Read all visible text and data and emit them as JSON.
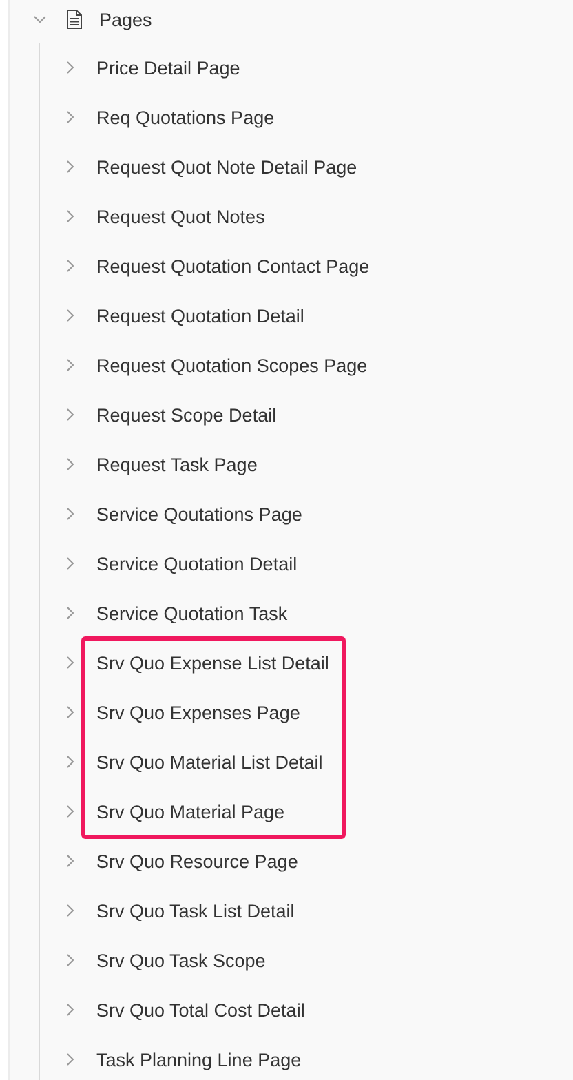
{
  "tree": {
    "label": "Pages",
    "expanded": true,
    "children": [
      {
        "label": "Price Detail Page",
        "expanded": false,
        "highlighted": false
      },
      {
        "label": "Req Quotations Page",
        "expanded": false,
        "highlighted": false
      },
      {
        "label": "Request Quot Note Detail Page",
        "expanded": false,
        "highlighted": false
      },
      {
        "label": "Request Quot Notes",
        "expanded": false,
        "highlighted": false
      },
      {
        "label": "Request Quotation Contact Page",
        "expanded": false,
        "highlighted": false
      },
      {
        "label": "Request Quotation Detail",
        "expanded": false,
        "highlighted": false
      },
      {
        "label": "Request Quotation Scopes Page",
        "expanded": false,
        "highlighted": false
      },
      {
        "label": "Request Scope Detail",
        "expanded": false,
        "highlighted": false
      },
      {
        "label": "Request Task Page",
        "expanded": false,
        "highlighted": false
      },
      {
        "label": "Service Qoutations Page",
        "expanded": false,
        "highlighted": false
      },
      {
        "label": "Service Quotation Detail",
        "expanded": false,
        "highlighted": false
      },
      {
        "label": "Service Quotation Task",
        "expanded": false,
        "highlighted": false
      },
      {
        "label": "Srv Quo Expense List Detail",
        "expanded": false,
        "highlighted": true
      },
      {
        "label": "Srv Quo Expenses Page",
        "expanded": false,
        "highlighted": true
      },
      {
        "label": "Srv Quo Material List Detail",
        "expanded": false,
        "highlighted": true
      },
      {
        "label": "Srv Quo Material Page",
        "expanded": false,
        "highlighted": true
      },
      {
        "label": "Srv Quo Resource Page",
        "expanded": false,
        "highlighted": false
      },
      {
        "label": "Srv Quo Task List Detail",
        "expanded": false,
        "highlighted": false
      },
      {
        "label": "Srv Quo Task Scope",
        "expanded": false,
        "highlighted": false
      },
      {
        "label": "Srv Quo Total Cost Detail",
        "expanded": false,
        "highlighted": false
      },
      {
        "label": "Task Planning Line Page",
        "expanded": false,
        "highlighted": false
      }
    ]
  }
}
